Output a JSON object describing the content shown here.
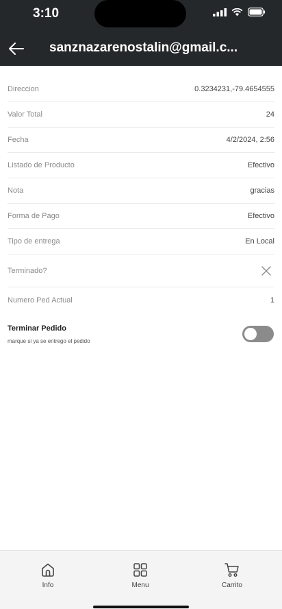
{
  "status_bar": {
    "time": "3:10"
  },
  "header": {
    "title": "sanznazarenostalin@gmail.c..."
  },
  "details": [
    {
      "label": "Direccion",
      "value": "0.3234231,-79.4654555"
    },
    {
      "label": "Valor Total",
      "value": "24"
    },
    {
      "label": "Fecha",
      "value": "4/2/2024, 2:56"
    },
    {
      "label": "Listado de Producto",
      "value": "Efectivo"
    },
    {
      "label": "Nota",
      "value": "gracias"
    },
    {
      "label": "Forma de Pago",
      "value": "Efectivo"
    },
    {
      "label": "Tipo de entrega",
      "value": "En Local"
    },
    {
      "label": "Terminado?",
      "icon": "close-icon"
    },
    {
      "label": "Numero Ped Actual",
      "value": "1"
    }
  ],
  "terminar": {
    "title": "Terminar Pedido",
    "subtitle": "marque si ya se entrego el pedido",
    "enabled": false
  },
  "bottom_nav": [
    {
      "label": "Info",
      "icon": "home-icon"
    },
    {
      "label": "Menu",
      "icon": "grid-icon"
    },
    {
      "label": "Carrito",
      "icon": "cart-icon"
    }
  ]
}
